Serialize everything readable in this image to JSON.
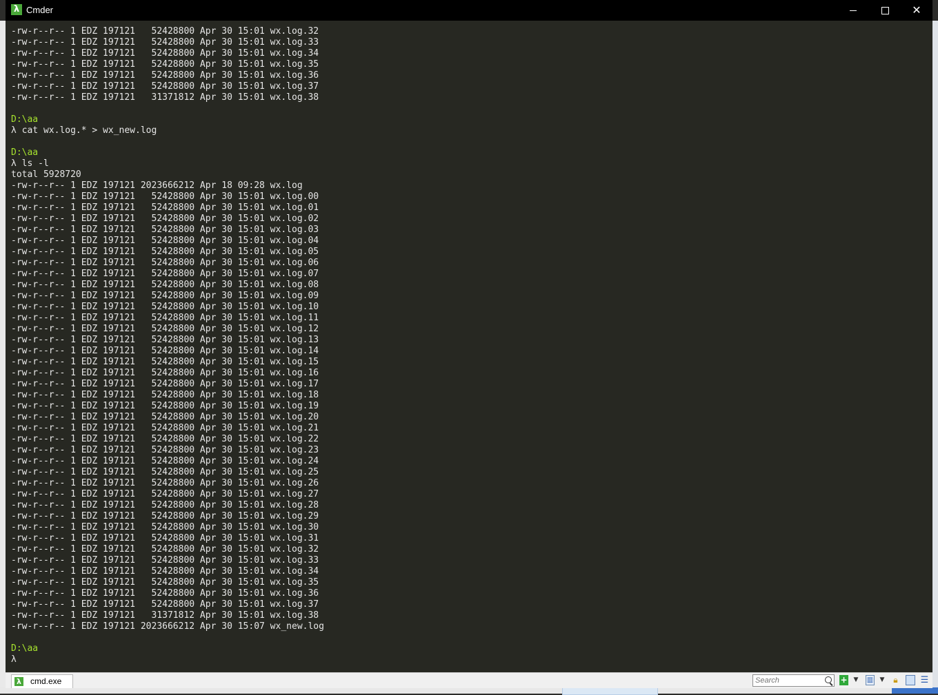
{
  "window": {
    "title": "Cmder",
    "controls": {
      "minimize": "minimize-icon",
      "maximize": "maximize-icon",
      "close": "close-icon"
    }
  },
  "console": {
    "lines": [
      {
        "text": "-rw-r--r-- 1 EDZ 197121   52428800 Apr 30 15:01 wx.log.32"
      },
      {
        "text": "-rw-r--r-- 1 EDZ 197121   52428800 Apr 30 15:01 wx.log.33"
      },
      {
        "text": "-rw-r--r-- 1 EDZ 197121   52428800 Apr 30 15:01 wx.log.34"
      },
      {
        "text": "-rw-r--r-- 1 EDZ 197121   52428800 Apr 30 15:01 wx.log.35"
      },
      {
        "text": "-rw-r--r-- 1 EDZ 197121   52428800 Apr 30 15:01 wx.log.36"
      },
      {
        "text": "-rw-r--r-- 1 EDZ 197121   52428800 Apr 30 15:01 wx.log.37"
      },
      {
        "text": "-rw-r--r-- 1 EDZ 197121   31371812 Apr 30 15:01 wx.log.38"
      },
      {
        "text": ""
      },
      {
        "text": "D:\\aa",
        "kind": "path"
      },
      {
        "text": "λ cat wx.log.* > wx_new.log"
      },
      {
        "text": ""
      },
      {
        "text": "D:\\aa",
        "kind": "path"
      },
      {
        "text": "λ ls -l"
      },
      {
        "text": "total 5928720"
      },
      {
        "text": "-rw-r--r-- 1 EDZ 197121 2023666212 Apr 18 09:28 wx.log"
      },
      {
        "text": "-rw-r--r-- 1 EDZ 197121   52428800 Apr 30 15:01 wx.log.00"
      },
      {
        "text": "-rw-r--r-- 1 EDZ 197121   52428800 Apr 30 15:01 wx.log.01"
      },
      {
        "text": "-rw-r--r-- 1 EDZ 197121   52428800 Apr 30 15:01 wx.log.02"
      },
      {
        "text": "-rw-r--r-- 1 EDZ 197121   52428800 Apr 30 15:01 wx.log.03"
      },
      {
        "text": "-rw-r--r-- 1 EDZ 197121   52428800 Apr 30 15:01 wx.log.04"
      },
      {
        "text": "-rw-r--r-- 1 EDZ 197121   52428800 Apr 30 15:01 wx.log.05"
      },
      {
        "text": "-rw-r--r-- 1 EDZ 197121   52428800 Apr 30 15:01 wx.log.06"
      },
      {
        "text": "-rw-r--r-- 1 EDZ 197121   52428800 Apr 30 15:01 wx.log.07"
      },
      {
        "text": "-rw-r--r-- 1 EDZ 197121   52428800 Apr 30 15:01 wx.log.08"
      },
      {
        "text": "-rw-r--r-- 1 EDZ 197121   52428800 Apr 30 15:01 wx.log.09"
      },
      {
        "text": "-rw-r--r-- 1 EDZ 197121   52428800 Apr 30 15:01 wx.log.10"
      },
      {
        "text": "-rw-r--r-- 1 EDZ 197121   52428800 Apr 30 15:01 wx.log.11"
      },
      {
        "text": "-rw-r--r-- 1 EDZ 197121   52428800 Apr 30 15:01 wx.log.12"
      },
      {
        "text": "-rw-r--r-- 1 EDZ 197121   52428800 Apr 30 15:01 wx.log.13"
      },
      {
        "text": "-rw-r--r-- 1 EDZ 197121   52428800 Apr 30 15:01 wx.log.14"
      },
      {
        "text": "-rw-r--r-- 1 EDZ 197121   52428800 Apr 30 15:01 wx.log.15"
      },
      {
        "text": "-rw-r--r-- 1 EDZ 197121   52428800 Apr 30 15:01 wx.log.16"
      },
      {
        "text": "-rw-r--r-- 1 EDZ 197121   52428800 Apr 30 15:01 wx.log.17"
      },
      {
        "text": "-rw-r--r-- 1 EDZ 197121   52428800 Apr 30 15:01 wx.log.18"
      },
      {
        "text": "-rw-r--r-- 1 EDZ 197121   52428800 Apr 30 15:01 wx.log.19"
      },
      {
        "text": "-rw-r--r-- 1 EDZ 197121   52428800 Apr 30 15:01 wx.log.20"
      },
      {
        "text": "-rw-r--r-- 1 EDZ 197121   52428800 Apr 30 15:01 wx.log.21"
      },
      {
        "text": "-rw-r--r-- 1 EDZ 197121   52428800 Apr 30 15:01 wx.log.22"
      },
      {
        "text": "-rw-r--r-- 1 EDZ 197121   52428800 Apr 30 15:01 wx.log.23"
      },
      {
        "text": "-rw-r--r-- 1 EDZ 197121   52428800 Apr 30 15:01 wx.log.24"
      },
      {
        "text": "-rw-r--r-- 1 EDZ 197121   52428800 Apr 30 15:01 wx.log.25"
      },
      {
        "text": "-rw-r--r-- 1 EDZ 197121   52428800 Apr 30 15:01 wx.log.26"
      },
      {
        "text": "-rw-r--r-- 1 EDZ 197121   52428800 Apr 30 15:01 wx.log.27"
      },
      {
        "text": "-rw-r--r-- 1 EDZ 197121   52428800 Apr 30 15:01 wx.log.28"
      },
      {
        "text": "-rw-r--r-- 1 EDZ 197121   52428800 Apr 30 15:01 wx.log.29"
      },
      {
        "text": "-rw-r--r-- 1 EDZ 197121   52428800 Apr 30 15:01 wx.log.30"
      },
      {
        "text": "-rw-r--r-- 1 EDZ 197121   52428800 Apr 30 15:01 wx.log.31"
      },
      {
        "text": "-rw-r--r-- 1 EDZ 197121   52428800 Apr 30 15:01 wx.log.32"
      },
      {
        "text": "-rw-r--r-- 1 EDZ 197121   52428800 Apr 30 15:01 wx.log.33"
      },
      {
        "text": "-rw-r--r-- 1 EDZ 197121   52428800 Apr 30 15:01 wx.log.34"
      },
      {
        "text": "-rw-r--r-- 1 EDZ 197121   52428800 Apr 30 15:01 wx.log.35"
      },
      {
        "text": "-rw-r--r-- 1 EDZ 197121   52428800 Apr 30 15:01 wx.log.36"
      },
      {
        "text": "-rw-r--r-- 1 EDZ 197121   52428800 Apr 30 15:01 wx.log.37"
      },
      {
        "text": "-rw-r--r-- 1 EDZ 197121   31371812 Apr 30 15:01 wx.log.38"
      },
      {
        "text": "-rw-r--r-- 1 EDZ 197121 2023666212 Apr 30 15:07 wx_new.log"
      },
      {
        "text": ""
      },
      {
        "text": "D:\\aa",
        "kind": "path"
      },
      {
        "text": "λ"
      }
    ],
    "colors": {
      "background": "#272822",
      "text": "#e6e6e6",
      "path": "#a6e22e"
    }
  },
  "tabbar": {
    "tab_label": "cmd.exe",
    "tab_icon": "lambda-icon",
    "search_placeholder": "Search",
    "tools": {
      "add_label": "+",
      "add_icon": "add-console-icon",
      "layout_icon": "layout-icon",
      "lock_icon": "lock-icon",
      "pane_icon": "split-pane-icon",
      "menu_icon": "hamburger-menu-icon"
    }
  }
}
